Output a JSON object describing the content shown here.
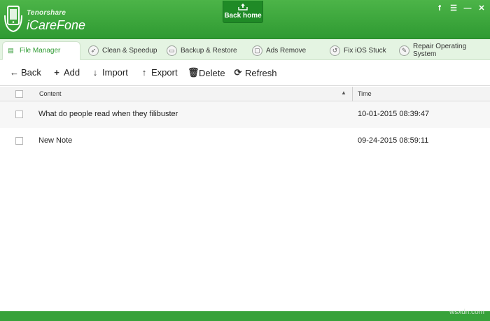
{
  "header": {
    "brand_small": "Tenorshare",
    "brand_name": "iCareFone",
    "back_home_label": "Back home",
    "window_buttons": [
      "f",
      "☰",
      "—",
      "✕"
    ]
  },
  "tabs": [
    {
      "label": "File Manager",
      "icon": "document-icon",
      "active": true
    },
    {
      "label": "Clean & Speedup",
      "icon": "rocket-icon"
    },
    {
      "label": "Backup & Restore",
      "icon": "folder-icon"
    },
    {
      "label": "Ads Remove",
      "icon": "ad-block-icon"
    },
    {
      "label": "Fix iOS Stuck",
      "icon": "fix-icon"
    },
    {
      "label": "Repair Operating System",
      "icon": "wrench-icon"
    }
  ],
  "toolbar": {
    "back": "Back",
    "add": "Add",
    "import": "Import",
    "export": "Export",
    "delete": "Delete",
    "refresh": "Refresh"
  },
  "table": {
    "columns": [
      "Content",
      "Time"
    ],
    "rows": [
      {
        "content": "What do people read when they filibuster",
        "time": "10-01-2015 08:39:47"
      },
      {
        "content": "New Note",
        "time": "09-24-2015 08:59:11"
      }
    ]
  },
  "watermark": "wsxdn.com",
  "colors": {
    "header_green": "#3aa63b",
    "accent_green": "#2e9a32",
    "tab_bar": "#e4f4e2"
  }
}
